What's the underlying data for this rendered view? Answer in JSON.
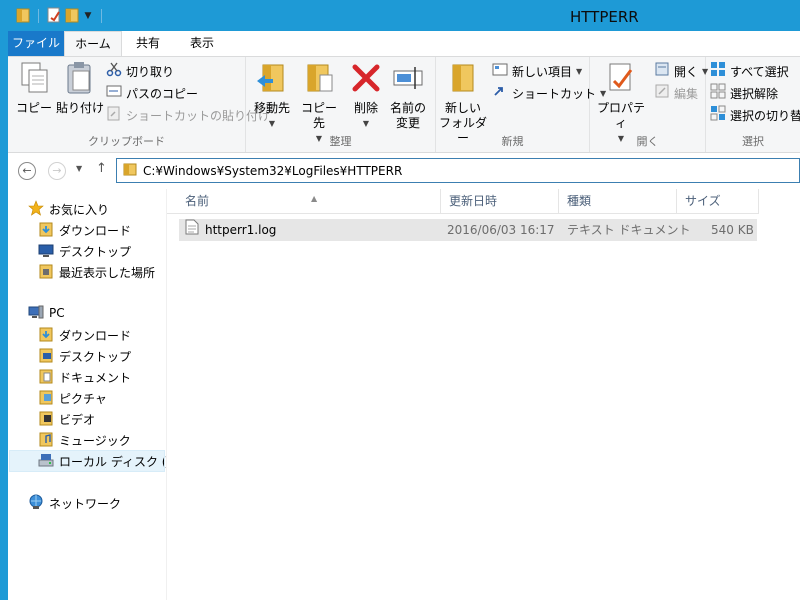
{
  "window": {
    "title": "HTTPERR"
  },
  "colors": {
    "accent": "#1e9ad6",
    "file_tab": "#1979ca",
    "folder": "#e9b949"
  },
  "ribbon_tabs": [
    "ファイル",
    "ホーム",
    "共有",
    "表示"
  ],
  "ribbon": {
    "clipboard": {
      "label": "クリップボード",
      "copy": "コピー",
      "paste": "貼り付け",
      "cut": "切り取り",
      "copy_path": "パスのコピー",
      "paste_shortcut": "ショートカットの貼り付け"
    },
    "organize": {
      "label": "整理",
      "move_to": "移動先",
      "copy_to": "コピー先",
      "delete": "削除",
      "rename_line1": "名前の",
      "rename_line2": "変更"
    },
    "new": {
      "label": "新規",
      "new_folder_line1": "新しい",
      "new_folder_line2": "フォルダー",
      "new_item": "新しい項目",
      "shortcut": "ショートカット"
    },
    "open": {
      "label": "開く",
      "properties": "プロパティ",
      "open": "開く",
      "edit": "編集"
    },
    "select": {
      "label": "選択",
      "select_all": "すべて選択",
      "select_none": "選択解除",
      "invert": "選択の切り替え"
    }
  },
  "address": {
    "path": "C:¥Windows¥System32¥LogFiles¥HTTPERR"
  },
  "nav": {
    "favorites": "お気に入り",
    "fav_items": [
      "ダウンロード",
      "デスクトップ",
      "最近表示した場所"
    ],
    "pc": "PC",
    "pc_items": [
      "ダウンロード",
      "デスクトップ",
      "ドキュメント",
      "ピクチャ",
      "ビデオ",
      "ミュージック",
      "ローカル ディスク (C:)"
    ],
    "network": "ネットワーク"
  },
  "columns": [
    "名前",
    "更新日時",
    "種類",
    "サイズ"
  ],
  "files": [
    {
      "name": "httperr1.log",
      "modified": "2016/06/03 16:17",
      "type": "テキスト ドキュメント",
      "size": "540 KB"
    }
  ]
}
